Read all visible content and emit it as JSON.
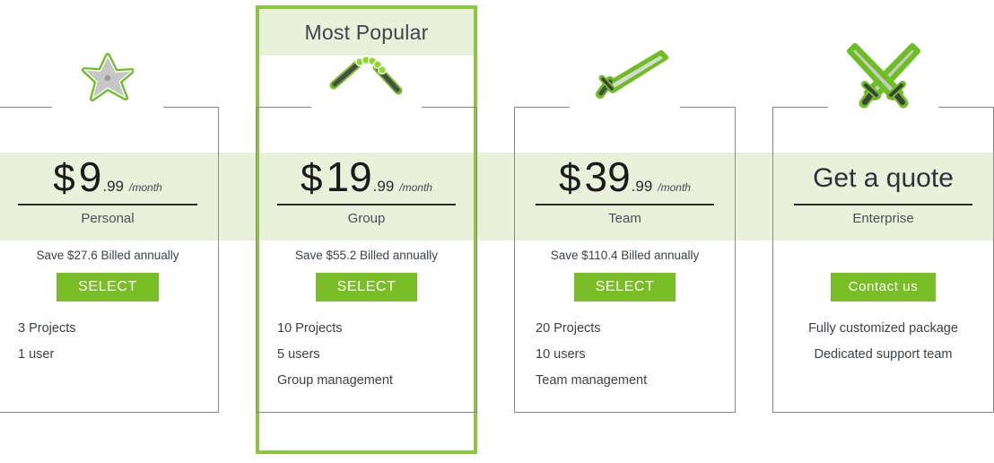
{
  "theme": {
    "band_color": "#e9f1da",
    "accent_green": "#8cc63e",
    "button_green": "#79bd27",
    "border_gray": "#888888",
    "text_dark": "#3c4246"
  },
  "highlight": {
    "badge_label": "Most Popular"
  },
  "plans": [
    {
      "id": "personal",
      "icon": "shuriken-star-icon",
      "currency": "$",
      "amount": "9",
      "cents": ".99",
      "period": "/month",
      "name": "Personal",
      "billed_note": "Save $27.6 Billed annually",
      "cta_label": "SELECT",
      "features": [
        "3 Projects",
        "1 user"
      ]
    },
    {
      "id": "group",
      "icon": "nunchaku-icon",
      "currency": "$",
      "amount": "19",
      "cents": ".99",
      "period": "/month",
      "name": "Group",
      "billed_note": "Save $55.2 Billed annually",
      "cta_label": "SELECT",
      "features": [
        "10 Projects",
        "5 users",
        "Group management"
      ]
    },
    {
      "id": "team",
      "icon": "katana-sword-icon",
      "currency": "$",
      "amount": "39",
      "cents": ".99",
      "period": "/month",
      "name": "Team",
      "billed_note": "Save $110.4 Billed annually",
      "cta_label": "SELECT",
      "features": [
        "20 Projects",
        "10 users",
        "Team management"
      ]
    },
    {
      "id": "enterprise",
      "icon": "crossed-swords-icon",
      "quote_label": "Get a quote",
      "name": "Enterprise",
      "billed_note": "",
      "cta_label": "Contact us",
      "features": [
        "Fully customized package",
        "Dedicated support team"
      ]
    }
  ]
}
